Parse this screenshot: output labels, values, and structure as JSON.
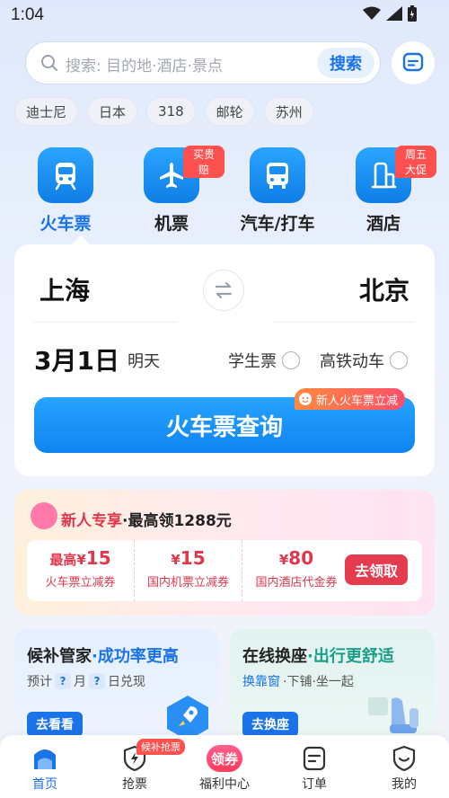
{
  "status_bar": {
    "time": "1:04"
  },
  "search": {
    "placeholder": "搜索: 目的地·酒店·景点",
    "button_label": "搜索"
  },
  "hot_chips": [
    "迪士尼",
    "日本",
    "318",
    "邮轮",
    "苏州"
  ],
  "categories": [
    {
      "label": "火车票",
      "icon": "train-icon",
      "badge": "",
      "active": true
    },
    {
      "label": "机票",
      "icon": "airplane-icon",
      "badge": "买贵赔",
      "active": false
    },
    {
      "label": "汽车/打车",
      "icon": "bus-icon",
      "badge": "",
      "active": false
    },
    {
      "label": "酒店",
      "icon": "hotel-icon",
      "badge": "周五大促",
      "active": false
    }
  ],
  "booking": {
    "from_city": "上海",
    "to_city": "北京",
    "date": "3月1日",
    "date_sub": "明天",
    "option_student": "学生票",
    "option_highspeed": "高铁动车",
    "query_button": "火车票查询",
    "query_badge": "新人火车票立减"
  },
  "promo": {
    "title_highlight": "新人专享",
    "title_rest": "·最高领1288元",
    "coupons": [
      {
        "prefix": "最高¥",
        "amount": "15",
        "desc": "火车票立减券"
      },
      {
        "prefix": "¥",
        "amount": "15",
        "desc": "国内机票立减券"
      },
      {
        "prefix": "¥",
        "amount": "80",
        "desc": "国内酒店代金券"
      }
    ],
    "claim_button": "去领取"
  },
  "cards": {
    "left": {
      "title_main": "候补管家",
      "title_highlight": "·成功率更高",
      "sub_prefix": "预计",
      "sub_q": "?",
      "sub_month": "月",
      "sub_day": "日兑现",
      "button": "去看看"
    },
    "right": {
      "title_main": "在线换座",
      "title_highlight": "·出行更舒适",
      "sub_highlight": "换靠窗",
      "sub_rest": "·下铺·坐一起",
      "button": "去换座"
    }
  },
  "tabbar": [
    {
      "label": "首页",
      "icon": "home-icon",
      "active": true
    },
    {
      "label": "抢票",
      "icon": "lightning-shield-icon",
      "badge": "候补抢票",
      "active": false
    },
    {
      "label": "福利中心",
      "icon": "coupon-icon",
      "badge_text": "领券",
      "active": false
    },
    {
      "label": "订单",
      "icon": "order-icon",
      "active": false
    },
    {
      "label": "我的",
      "icon": "profile-icon",
      "active": false
    }
  ],
  "colors": {
    "accent": "#1a73e8",
    "promo_red": "#e0374c",
    "badge_red": "#ff5050"
  }
}
